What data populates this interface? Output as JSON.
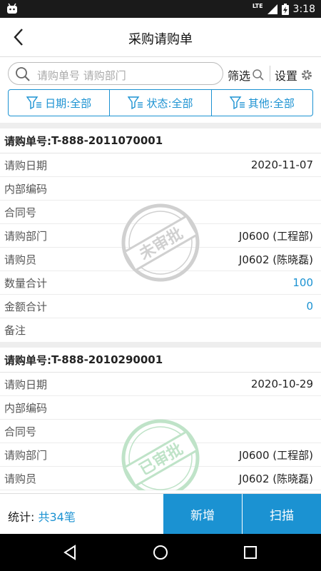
{
  "status_bar": {
    "time": "3:18",
    "network": "LTE"
  },
  "header": {
    "title": "采购请购单"
  },
  "search": {
    "placeholder": "请购单号 请购部门"
  },
  "toolbar": {
    "filter_label": "筛选",
    "settings_label": "设置"
  },
  "filter_tabs": [
    {
      "label": "日期:全部"
    },
    {
      "label": "状态:全部"
    },
    {
      "label": "其他:全部"
    }
  ],
  "orders": [
    {
      "title_label": "请购单号:",
      "number": "T-888-2011070001",
      "stamp": "未审批",
      "fields": [
        {
          "label": "请购日期",
          "value": "2020-11-07"
        },
        {
          "label": "内部编码",
          "value": ""
        },
        {
          "label": "合同号",
          "value": ""
        },
        {
          "label": "请购部门",
          "value": "J0600 (工程部)"
        },
        {
          "label": "请购员",
          "value": "J0602 (陈晓磊)"
        },
        {
          "label": "数量合计",
          "value": "100"
        },
        {
          "label": "金额合计",
          "value": "0"
        },
        {
          "label": "备注",
          "value": ""
        }
      ]
    },
    {
      "title_label": "请购单号:",
      "number": "T-888-2010290001",
      "stamp": "已审批",
      "fields": [
        {
          "label": "请购日期",
          "value": "2020-10-29"
        },
        {
          "label": "内部编码",
          "value": ""
        },
        {
          "label": "合同号",
          "value": ""
        },
        {
          "label": "请购部门",
          "value": "J0600 (工程部)"
        },
        {
          "label": "请购员",
          "value": "J0602 (陈晓磊)"
        }
      ]
    }
  ],
  "footer": {
    "stats_label": "统计:",
    "stats_value": "共34笔",
    "add_label": "新增",
    "scan_label": "扫描"
  },
  "colors": {
    "accent": "#1b92d2",
    "stamp_pending": "#cfcfcf",
    "stamp_approved": "#bfe3c8"
  }
}
